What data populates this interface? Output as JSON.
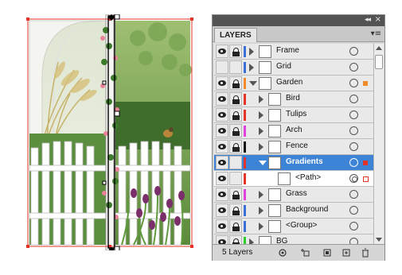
{
  "panel": {
    "collapse_glyph": "◂◂",
    "close_glyph": "×",
    "tab_label": "LAYERS",
    "menu_glyph": "▾≡",
    "footer_count": "5 Layers"
  },
  "layers": [
    {
      "label": "Frame",
      "color": "#3b6fd6",
      "state": "collapsed",
      "visible": true,
      "locked": true
    },
    {
      "label": "Grid",
      "color": "#3b6fd6",
      "state": "collapsed",
      "visible": false,
      "locked": false
    },
    {
      "label": "Garden",
      "color": "#f08a2a",
      "state": "expanded",
      "visible": true,
      "locked": true
    },
    {
      "label": "Bird",
      "color": "#e6332a",
      "state": "collapsed",
      "visible": true,
      "locked": true
    },
    {
      "label": "Tulips",
      "color": "#e6332a",
      "state": "collapsed",
      "visible": true,
      "locked": true
    },
    {
      "label": "Arch",
      "color": "#e040e0",
      "state": "collapsed",
      "visible": true,
      "locked": true
    },
    {
      "label": "Fence",
      "color": "#111111",
      "state": "collapsed",
      "visible": true,
      "locked": true
    },
    {
      "label": "Gradients",
      "color": "#e6332a",
      "state": "expanded",
      "visible": true,
      "locked": false,
      "selected": true
    },
    {
      "label": "<Path>",
      "color": "#e6332a",
      "state": "none",
      "visible": true,
      "locked": false
    },
    {
      "label": "Grass",
      "color": "#e040e0",
      "state": "collapsed",
      "visible": true,
      "locked": true
    },
    {
      "label": "Background",
      "color": "#3b6fd6",
      "state": "collapsed",
      "visible": true,
      "locked": true
    },
    {
      "label": "<Group>",
      "color": "#3b6fd6",
      "state": "collapsed",
      "visible": true,
      "locked": true
    },
    {
      "label": "BG",
      "color": "#2acd2a",
      "state": "collapsed",
      "visible": true,
      "locked": true
    }
  ],
  "colors": {
    "selection_red": "#e6332a",
    "garden_orange": "#f08a2a",
    "row_selected": "#3d83d6"
  }
}
